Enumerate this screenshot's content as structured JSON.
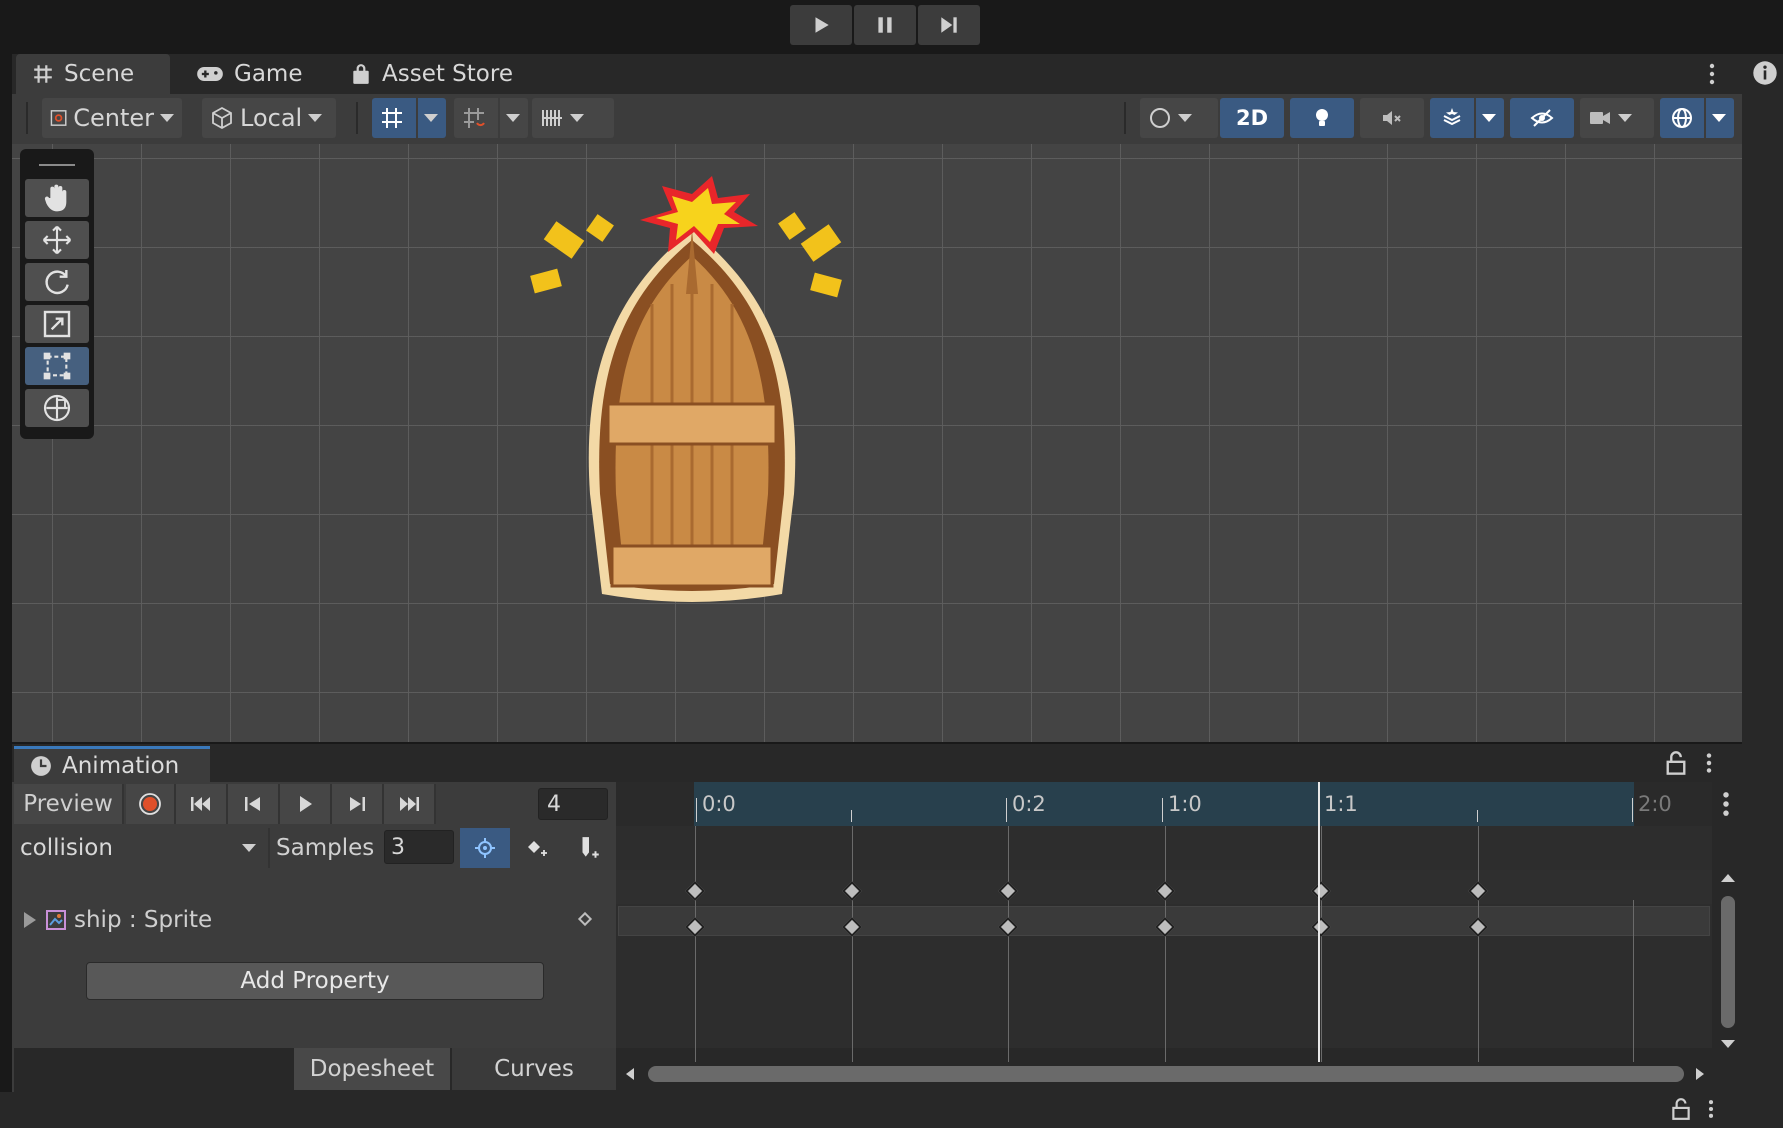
{
  "playbar": {
    "play_icon": "play-icon",
    "pause_icon": "pause-icon",
    "step_icon": "step-forward-icon"
  },
  "scene_tabs": [
    {
      "label": "Scene",
      "icon": "grid-hash-icon"
    },
    {
      "label": "Game",
      "icon": "gamepad-icon"
    },
    {
      "label": "Asset Store",
      "icon": "shopping-bag-icon"
    }
  ],
  "scene_toolbar": {
    "pivot_label": "Center",
    "space_label": "Local",
    "mode_2d_label": "2D"
  },
  "tools": [
    {
      "name": "hand-tool",
      "icon": "hand-icon"
    },
    {
      "name": "move-tool",
      "icon": "move-arrows-icon"
    },
    {
      "name": "rotate-tool",
      "icon": "rotate-icon"
    },
    {
      "name": "scale-tool",
      "icon": "scale-icon"
    },
    {
      "name": "rect-tool",
      "icon": "rect-transform-icon",
      "selected": true
    },
    {
      "name": "transform-tool",
      "icon": "transform-icon"
    }
  ],
  "animation": {
    "tab_label": "Animation",
    "preview_label": "Preview",
    "current_frame": "4",
    "clip_name": "collision",
    "samples_label": "Samples",
    "samples_value": "3",
    "property_label": "ship : Sprite",
    "add_property_label": "Add Property",
    "dopesheet_label": "Dopesheet",
    "curves_label": "Curves",
    "ruler_labels": [
      "0:0",
      "0:2",
      "1:0",
      "1:1",
      "2:0"
    ],
    "keyframe_count": 6,
    "accent_color": "#3a79bb",
    "record_color": "#e0502a"
  },
  "colors": {
    "selected_blue": "#3a5a82",
    "panel_bg": "#3c3c3c",
    "timeline_range": "#28404d"
  }
}
